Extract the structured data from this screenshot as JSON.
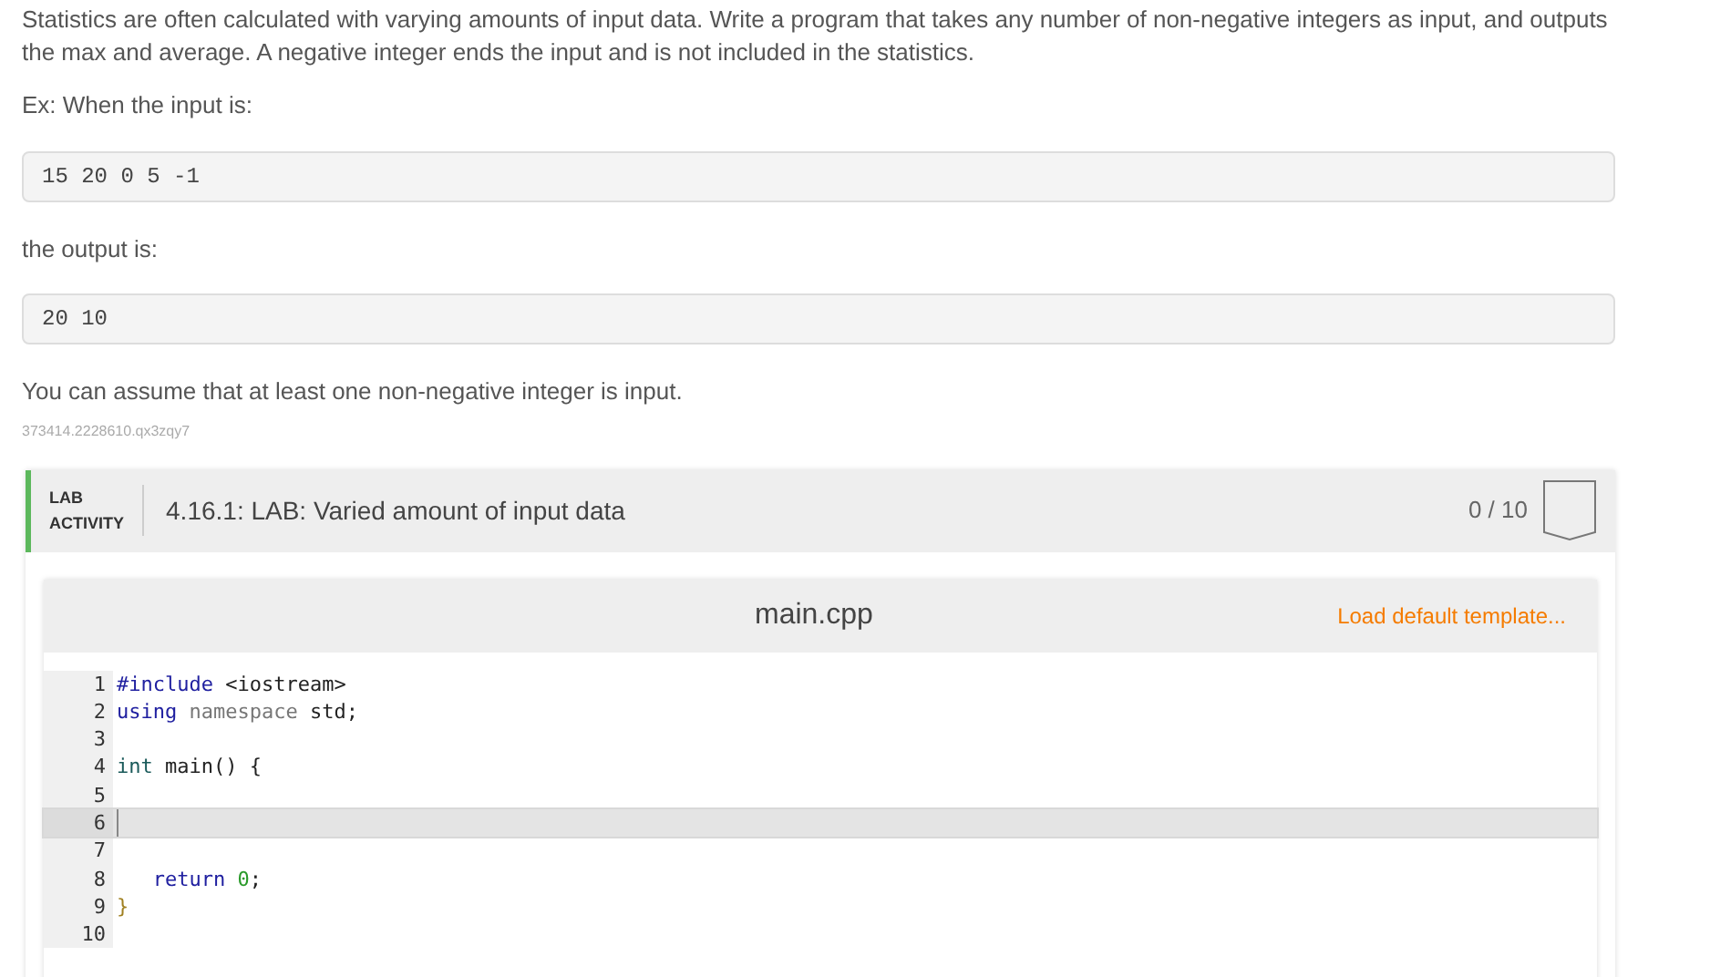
{
  "description": "Statistics are often calculated with varying amounts of input data. Write a program that takes any number of non-negative integers as input, and outputs the max and average. A negative integer ends the input and is not included in the statistics.",
  "example_input_label": "Ex: When the input is:",
  "example_input": "15 20 0 5 -1",
  "example_output_label": "the output is:",
  "example_output": "20 10",
  "note": "You can assume that at least one non-negative integer is input.",
  "problem_id": "373414.2228610.qx3zqy7",
  "lab": {
    "badge_line_1": "LAB",
    "badge_line_2": "ACTIVITY",
    "title": "4.16.1: LAB: Varied amount of input data",
    "score": "0 / 10",
    "completed": false
  },
  "editor": {
    "filename": "main.cpp",
    "load_template": "Load default template...",
    "lines": [
      {
        "number": "1",
        "selected": false,
        "tokens": [
          {
            "kind": "keyword",
            "text": "#include"
          },
          {
            "kind": "plain",
            "text": " <iostream>"
          }
        ]
      },
      {
        "number": "2",
        "selected": false,
        "tokens": [
          {
            "kind": "keyword",
            "text": "using"
          },
          {
            "kind": "muted",
            "text": " namespace"
          },
          {
            "kind": "plain",
            "text": " std;"
          }
        ]
      },
      {
        "number": "3",
        "selected": false
      },
      {
        "number": "4",
        "selected": false,
        "tokens": [
          {
            "kind": "type",
            "text": "int"
          },
          {
            "kind": "plain",
            "text": " main() {"
          }
        ]
      },
      {
        "number": "5",
        "selected": false
      },
      {
        "number": "6",
        "selected": true
      },
      {
        "number": "7",
        "selected": false
      },
      {
        "number": "8",
        "selected": false,
        "tokens": [
          {
            "kind": "keyword",
            "text": "   return"
          },
          {
            "kind": "number",
            "text": " 0"
          },
          {
            "kind": "plain",
            "text": ";"
          }
        ]
      },
      {
        "number": "9",
        "selected": false,
        "tokens": [
          {
            "kind": "brace",
            "text": "}"
          }
        ]
      },
      {
        "number": "10",
        "selected": false
      }
    ]
  }
}
